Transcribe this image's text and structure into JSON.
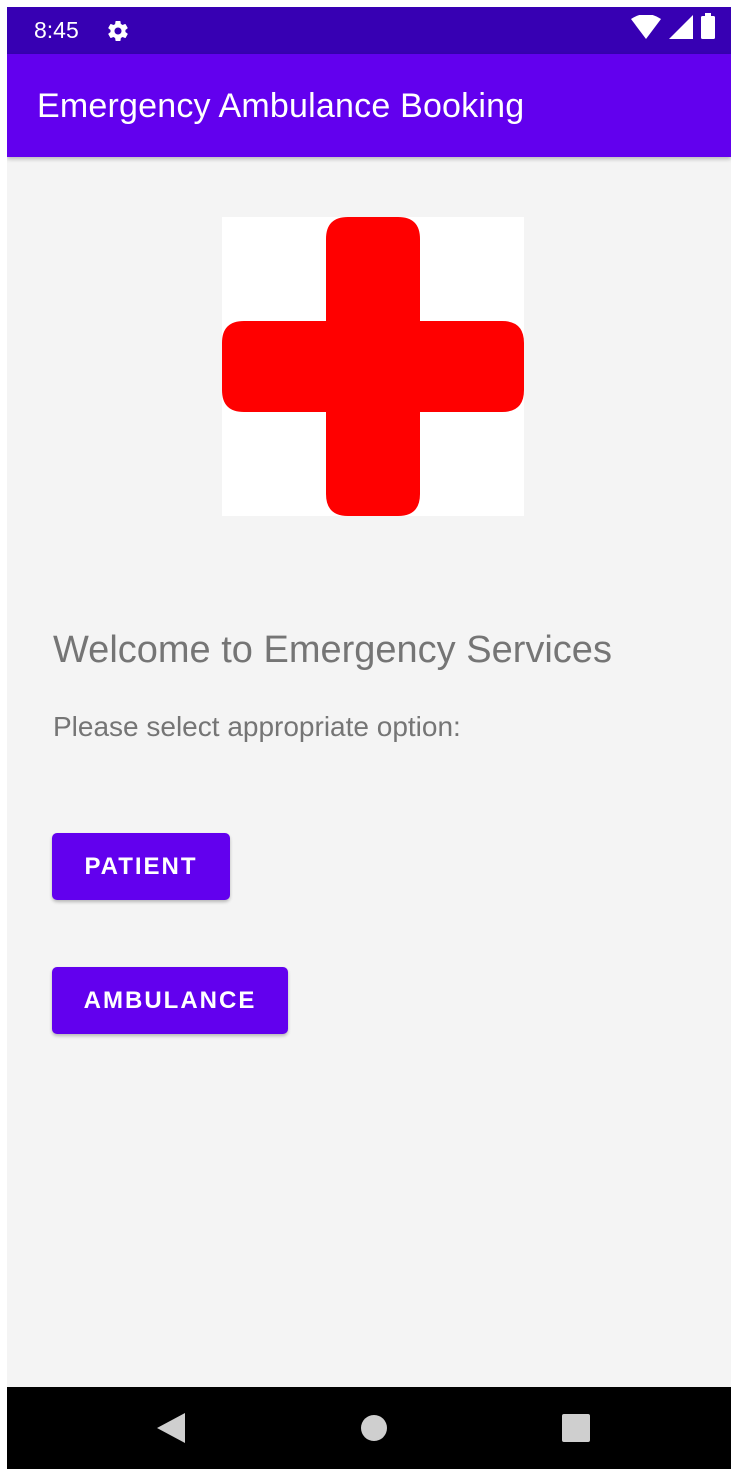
{
  "status_bar": {
    "time": "8:45",
    "icons": [
      "settings-gear-icon",
      "wifi-icon",
      "cellular-signal-icon",
      "battery-icon"
    ]
  },
  "app_bar": {
    "title": "Emergency Ambulance Booking"
  },
  "logo": {
    "icon": "red-cross-icon",
    "color": "#ff0000"
  },
  "main": {
    "welcome": "Welcome to Emergency Services",
    "prompt": "Please select appropriate option:",
    "buttons": {
      "patient": "PATIENT",
      "ambulance": "AMBULANCE"
    }
  },
  "nav_bar": {
    "icons": [
      "back-icon",
      "home-icon",
      "recent-apps-icon"
    ]
  },
  "colors": {
    "status_bar": "#3700b3",
    "primary": "#6200ee",
    "background": "#f4f4f4",
    "text_secondary": "#757575"
  }
}
